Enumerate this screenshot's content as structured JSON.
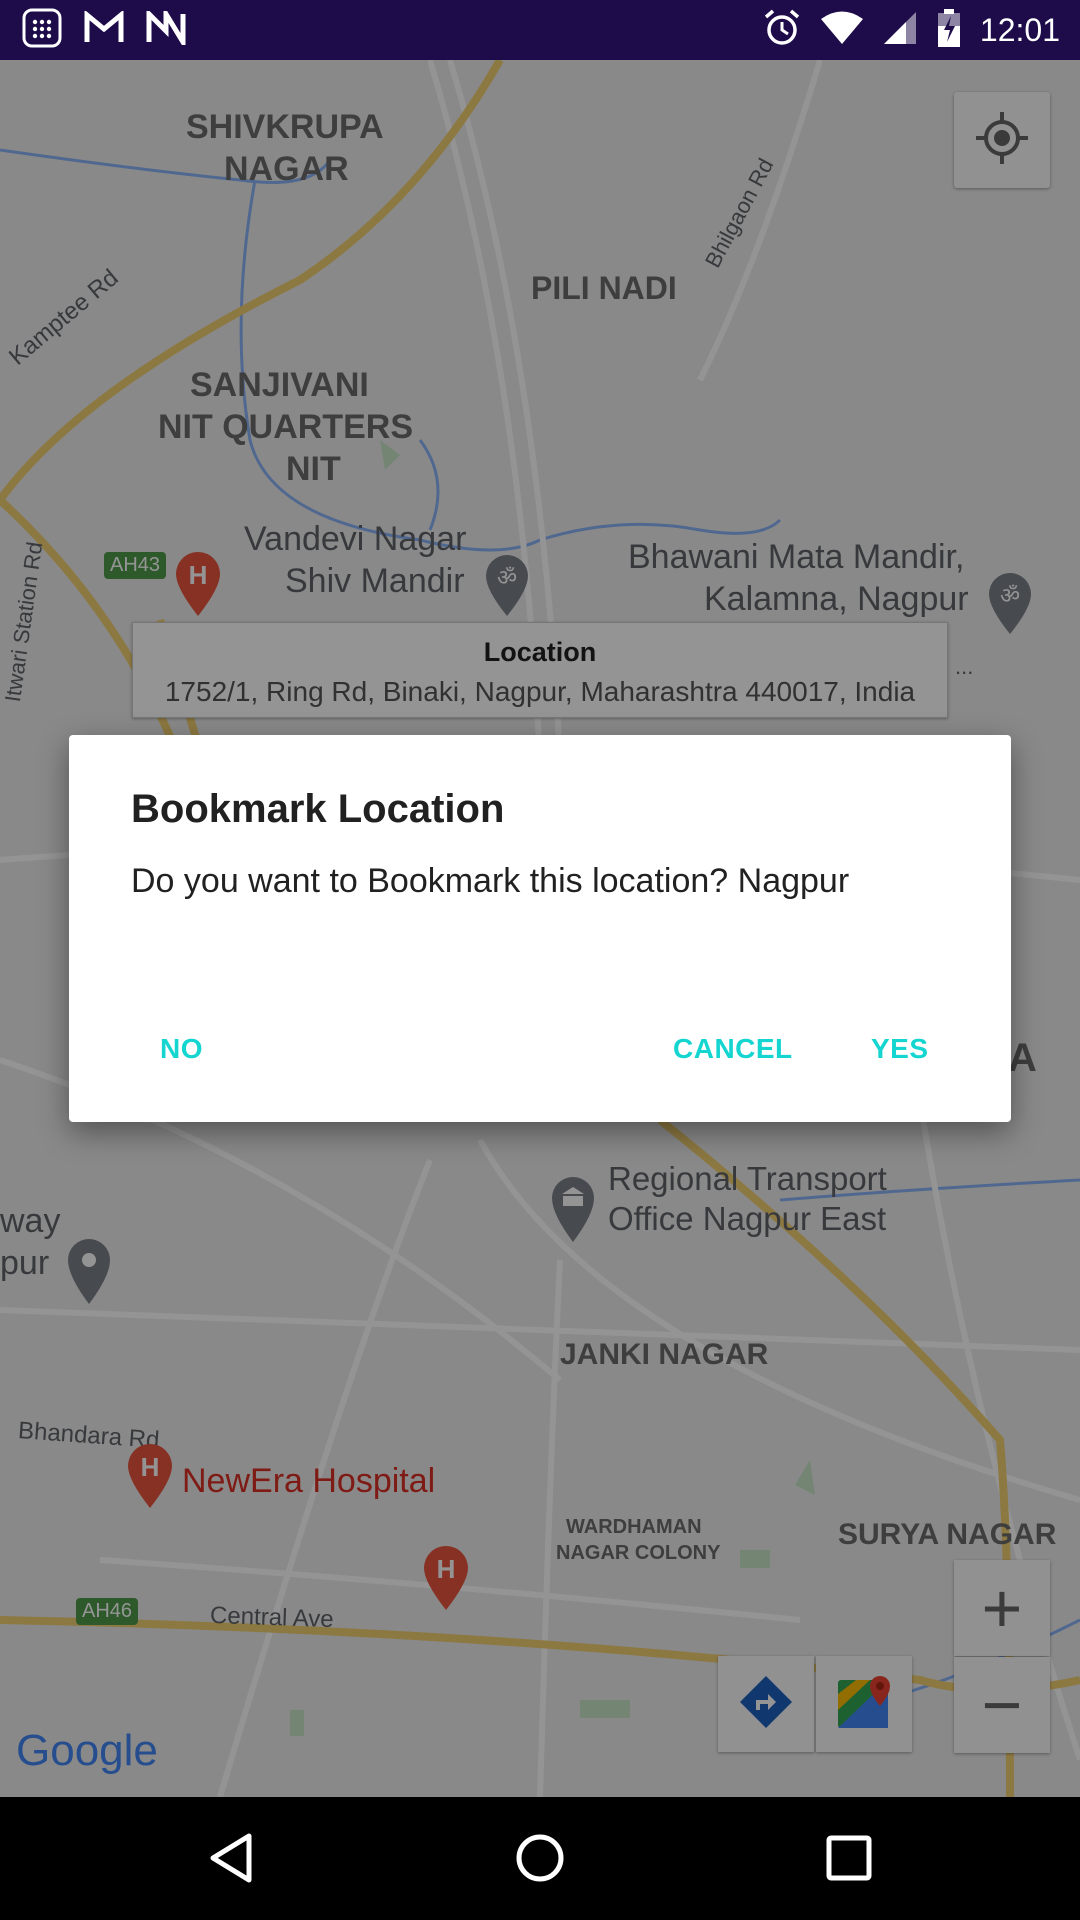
{
  "status_bar": {
    "time": "12:01",
    "left_icons": [
      "calculator-icon",
      "gmail-icon",
      "notification-n-icon"
    ],
    "right_icons": [
      "alarm-icon",
      "wifi-icon",
      "signal-icon",
      "battery-icon"
    ]
  },
  "map": {
    "labels": [
      "SHIVKRUPA",
      "NAGAR",
      "PILI NADI",
      "SANJIVANI",
      "NIT QUARTERS",
      "NIT",
      "Vandevi Nagar",
      "Shiv Mandir",
      "Bhawani Mata Mandir,",
      "Kalamna, Nagpur",
      "Regional Transport",
      "Office Nagpur East",
      "JANKI NAGAR",
      "NewEra Hospital",
      "WARDHAMAN",
      "NAGAR COLONY",
      "SURYA NAGAR",
      "Central Ave",
      "Bhandara Rd",
      "Kamptee Rd",
      "Bhilgaon Rd",
      "Itwari Station Rd",
      "AH43",
      "AH46",
      "way",
      "pur",
      "A",
      "..."
    ],
    "google_logo": "Google",
    "colors": {
      "road": "#f7d26a",
      "water": "#8ab4f8",
      "park": "#c8e6c9"
    }
  },
  "info_window": {
    "title": "Location",
    "address": "1752/1, Ring Rd, Binaki, Nagpur, Maharashtra 440017, India"
  },
  "dialog": {
    "title": "Bookmark Location",
    "message": "Do you want to Bookmark this location? Nagpur",
    "btn_no": "NO",
    "btn_cancel": "CANCEL",
    "btn_yes": "YES",
    "accent": "#14d5d0"
  },
  "map_controls": {
    "zoom_in": "+",
    "zoom_out": "−"
  }
}
